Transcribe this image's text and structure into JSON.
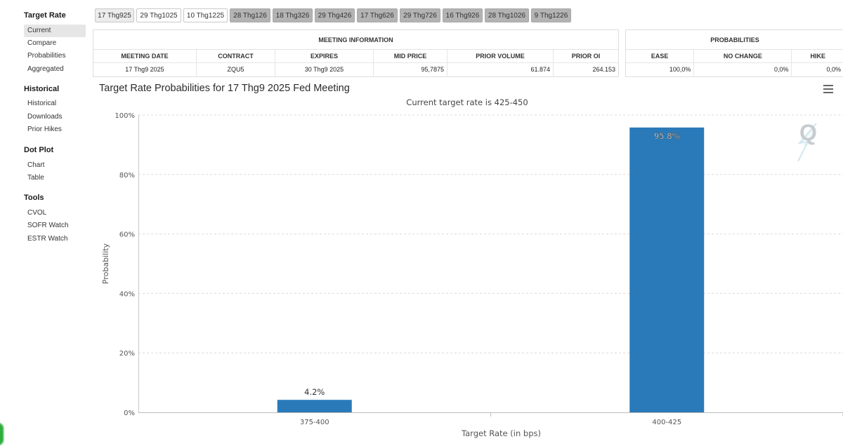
{
  "sidebar": {
    "target_rate": {
      "heading": "Target Rate",
      "items": [
        "Current",
        "Compare",
        "Probabilities",
        "Aggregated"
      ]
    },
    "historical": {
      "heading": "Historical",
      "items": [
        "Historical",
        "Downloads",
        "Prior Hikes"
      ]
    },
    "dot_plot": {
      "heading": "Dot Plot",
      "items": [
        "Chart",
        "Table"
      ]
    },
    "tools": {
      "heading": "Tools",
      "items": [
        "CVOL",
        "SOFR Watch",
        "ESTR Watch"
      ]
    }
  },
  "tabs": [
    "17 Thg925",
    "29 Thg1025",
    "10 Thg1225",
    "28 Thg126",
    "18 Thg326",
    "29 Thg426",
    "17 Thg626",
    "29 Thg726",
    "16 Thg926",
    "28 Thg1026",
    "9 Thg1226"
  ],
  "meeting_info": {
    "caption": "MEETING INFORMATION",
    "headers": [
      "MEETING DATE",
      "CONTRACT",
      "EXPIRES",
      "MID PRICE",
      "PRIOR VOLUME",
      "PRIOR OI"
    ],
    "values": [
      "17 Thg9 2025",
      "ZQU5",
      "30 Thg9 2025",
      "95,7875",
      "61.874",
      "264.153"
    ]
  },
  "probabilities": {
    "caption": "PROBABILITIES",
    "headers": [
      "EASE",
      "NO CHANGE",
      "HIKE"
    ],
    "values": [
      "100,0%",
      "0,0%",
      "0,0%"
    ]
  },
  "chart": {
    "title": "Target Rate Probabilities for 17 Thg9 2025 Fed Meeting",
    "subtitle": "Current target rate is 425-450",
    "logo_text": "Q"
  },
  "colors": {
    "bar": "#2a7ab9",
    "grid": "#dcdcdc",
    "active_tab": "#ececec",
    "inactive_tab": "#b3b3b3"
  },
  "chart_data": {
    "type": "bar",
    "categories": [
      "375-400",
      "400-425"
    ],
    "values": [
      4.2,
      95.8
    ],
    "value_labels": [
      "4.2%",
      "95.8%"
    ],
    "title": "Target Rate Probabilities for 17 Thg9 2025 Fed Meeting",
    "subtitle": "Current target rate is 425-450",
    "xlabel": "Target Rate (in bps)",
    "ylabel": "Probability",
    "ylim": [
      0,
      100
    ],
    "yticks": [
      "0%",
      "20%",
      "40%",
      "60%",
      "80%",
      "100%"
    ],
    "grid": true,
    "legend": "none"
  }
}
